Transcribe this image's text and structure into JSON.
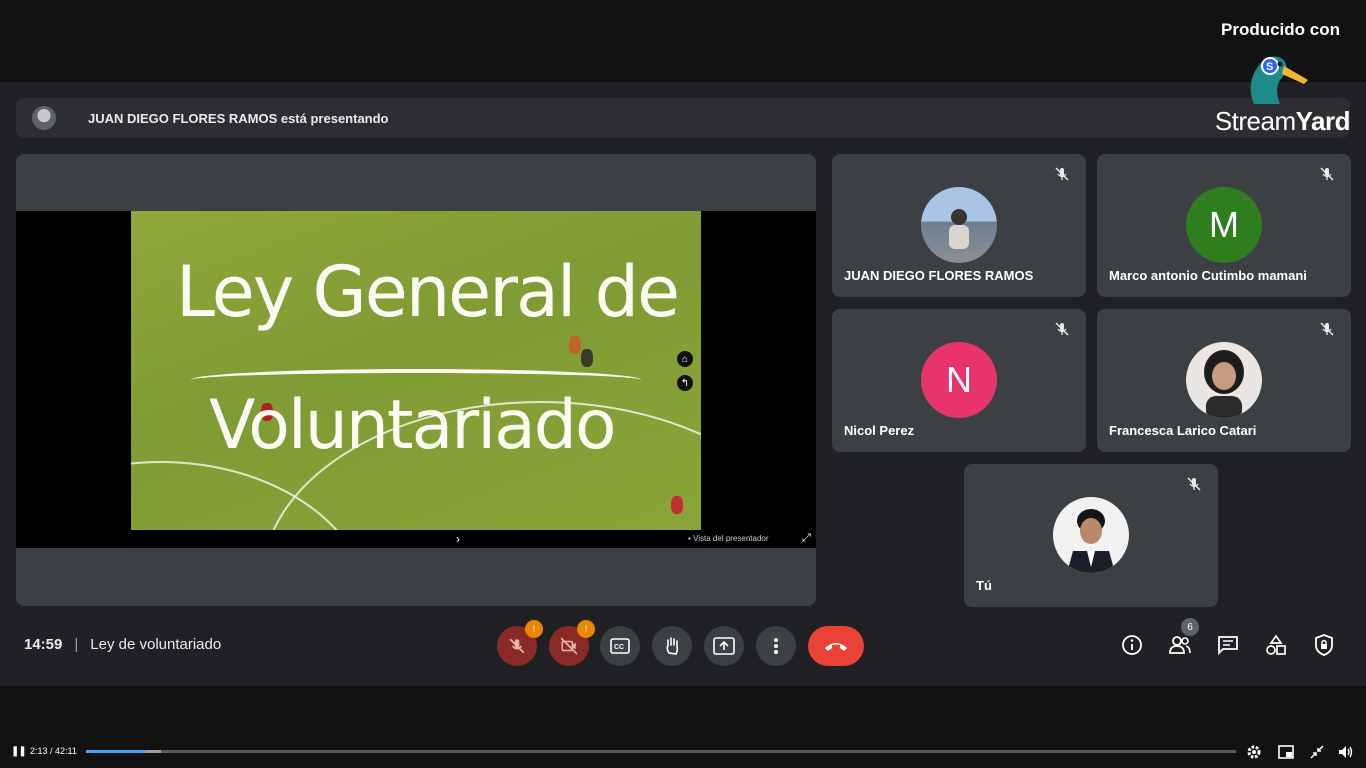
{
  "branding": {
    "produced_with": "Producido con",
    "brand_prefix": "Stream",
    "brand_suffix": "Yard"
  },
  "presenter_banner": {
    "text": "JUAN DIEGO FLORES RAMOS está presentando"
  },
  "presentation": {
    "slide_title_line1": "Ley General de",
    "slide_title_line2": "Voluntariado",
    "footer_presenter_view": "Vista del presentador"
  },
  "participants": [
    {
      "name": "JUAN DIEGO FLORES RAMOS",
      "avatar": "photo",
      "muted": true
    },
    {
      "name": "Marco antonio Cutimbo mamani",
      "avatar_letter": "M",
      "avatar_color": "#2e7d1f",
      "muted": true
    },
    {
      "name": "Nicol Perez",
      "avatar_letter": "N",
      "avatar_color": "#e8336d",
      "muted": true
    },
    {
      "name": "Francesca Larico Catari",
      "avatar": "photo",
      "muted": true
    },
    {
      "name": "Tú",
      "avatar": "photo",
      "muted": true
    }
  ],
  "meeting": {
    "time": "14:59",
    "separator": "|",
    "title": "Ley de voluntariado"
  },
  "controls": {
    "mic_badge": "!",
    "camera_badge": "!",
    "people_count": "6",
    "icons": [
      "mic-off-icon",
      "camera-off-icon",
      "captions-icon",
      "raise-hand-icon",
      "present-icon",
      "more-options-icon",
      "end-call-icon",
      "info-icon",
      "people-icon",
      "chat-icon",
      "activities-icon",
      "host-controls-icon"
    ]
  },
  "video_player": {
    "current_time": "2:13",
    "duration": "42:11",
    "time_display": "2:13 / 42:11",
    "progress": 0.0526,
    "buffered": 0.065
  },
  "colors": {
    "end_call": "#ea4335",
    "progress": "#3ea6ff",
    "meet_bg": "#202124",
    "tile_bg": "#3c4043"
  }
}
